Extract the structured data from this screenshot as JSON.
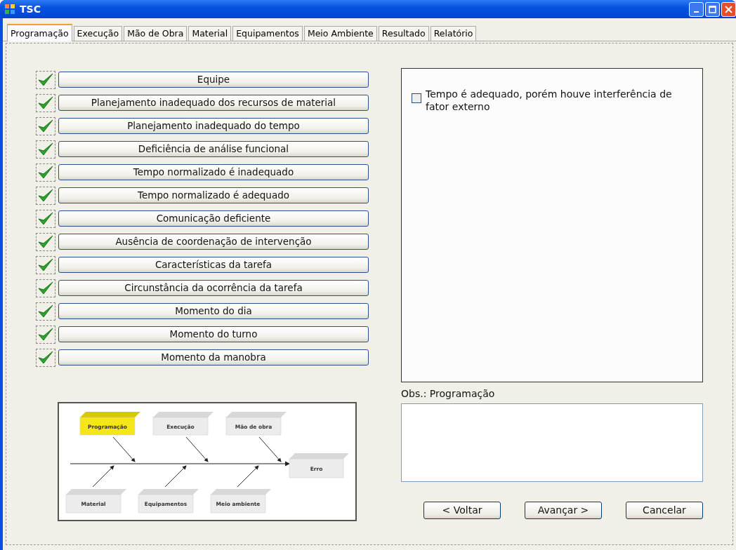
{
  "window": {
    "title": "TSC"
  },
  "tabs": [
    {
      "label": "Programação",
      "selected": true
    },
    {
      "label": "Execução",
      "selected": false
    },
    {
      "label": "Mão de Obra",
      "selected": false
    },
    {
      "label": "Material",
      "selected": false
    },
    {
      "label": "Equipamentos",
      "selected": false
    },
    {
      "label": "Meio Ambiente",
      "selected": false
    },
    {
      "label": "Resultado",
      "selected": false
    },
    {
      "label": "Relatório",
      "selected": false
    }
  ],
  "factors": [
    {
      "label": "Equipe",
      "checked": true
    },
    {
      "label": "Planejamento inadequado dos recursos de material",
      "checked": true
    },
    {
      "label": "Planejamento inadequado do tempo",
      "checked": true
    },
    {
      "label": "Deficiência de análise funcional",
      "checked": true
    },
    {
      "label": "Tempo normalizado é inadequado",
      "checked": true
    },
    {
      "label": "Tempo normalizado é adequado",
      "checked": true
    },
    {
      "label": "Comunicação deficiente",
      "checked": true
    },
    {
      "label": "Ausência de coordenação de intervenção",
      "checked": true
    },
    {
      "label": "Características da tarefa",
      "checked": true
    },
    {
      "label": "Circunstância da ocorrência da tarefa",
      "checked": true
    },
    {
      "label": "Momento do dia",
      "checked": true
    },
    {
      "label": "Momento do turno",
      "checked": true
    },
    {
      "label": "Momento da manobra",
      "checked": true
    }
  ],
  "options": [
    {
      "label": "Tempo é adequado, porém houve interferência de fator externo",
      "checked": false
    }
  ],
  "diagram": {
    "causes": [
      {
        "label": "Programação",
        "kind": "top",
        "selected": true
      },
      {
        "label": "Execução",
        "kind": "top",
        "selected": false
      },
      {
        "label": "Mão de obra",
        "kind": "top",
        "selected": false
      },
      {
        "label": "Material",
        "kind": "bottom",
        "selected": false
      },
      {
        "label": "Equipamentos",
        "kind": "bottom",
        "selected": false
      },
      {
        "label": "Meio ambiente",
        "kind": "bottom",
        "selected": false
      }
    ],
    "effect": "Erro"
  },
  "obs": {
    "label": "Obs.: Programação"
  },
  "buttons": [
    {
      "label": "< Voltar"
    },
    {
      "label": "Avançar >"
    },
    {
      "label": "Cancelar"
    }
  ]
}
